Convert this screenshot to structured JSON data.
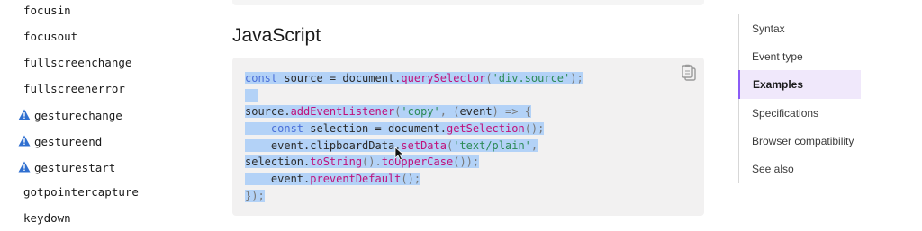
{
  "sidebar": {
    "items": [
      {
        "label": "focusin",
        "deprecated": false
      },
      {
        "label": "focusout",
        "deprecated": false
      },
      {
        "label": "fullscreenchange",
        "deprecated": false
      },
      {
        "label": "fullscreenerror",
        "deprecated": false
      },
      {
        "label": "gesturechange",
        "deprecated": true
      },
      {
        "label": "gestureend",
        "deprecated": true
      },
      {
        "label": "gesturestart",
        "deprecated": true
      },
      {
        "label": "gotpointercapture",
        "deprecated": false
      },
      {
        "label": "keydown",
        "deprecated": false
      }
    ],
    "warning_icon": "warning-triangle-icon",
    "warning_color": "#2f6fd0"
  },
  "main": {
    "heading": "JavaScript",
    "code_language": "JavaScript",
    "copy_icon": "clipboard-copy-icon",
    "selection_color": "#b3d2f7",
    "code_lines": [
      [
        [
          "kw",
          "const"
        ],
        [
          "pl",
          " source = document."
        ],
        [
          "fn",
          "querySelector"
        ],
        [
          "pun",
          "("
        ],
        [
          "str",
          "'div.source'"
        ],
        [
          "pun",
          ");"
        ]
      ],
      [],
      [
        [
          "pl",
          "source."
        ],
        [
          "fn",
          "addEventListener"
        ],
        [
          "pun",
          "("
        ],
        [
          "str",
          "'copy'"
        ],
        [
          "pun",
          ", ("
        ],
        [
          "pl",
          "event"
        ],
        [
          "pun",
          ") => {"
        ]
      ],
      [
        [
          "pl",
          "    "
        ],
        [
          "kw",
          "const"
        ],
        [
          "pl",
          " selection = document."
        ],
        [
          "fn",
          "getSelection"
        ],
        [
          "pun",
          "();"
        ]
      ],
      [
        [
          "pl",
          "    event.clipboardData."
        ],
        [
          "fn",
          "setData"
        ],
        [
          "pun",
          "("
        ],
        [
          "str",
          "'text/plain'"
        ],
        [
          "pun",
          ","
        ]
      ],
      [
        [
          "pl",
          "selection."
        ],
        [
          "fn",
          "toString"
        ],
        [
          "pun",
          "()."
        ],
        [
          "fn",
          "toUpperCase"
        ],
        [
          "pun",
          "());"
        ]
      ],
      [
        [
          "pl",
          "    event."
        ],
        [
          "fn",
          "preventDefault"
        ],
        [
          "pun",
          "();"
        ]
      ],
      [
        [
          "pun",
          "});"
        ]
      ]
    ]
  },
  "toc": {
    "items": [
      {
        "label": "Syntax",
        "active": false
      },
      {
        "label": "Event type",
        "active": false
      },
      {
        "label": "Examples",
        "active": true
      },
      {
        "label": "Specifications",
        "active": false
      },
      {
        "label": "Browser compatibility",
        "active": false
      },
      {
        "label": "See also",
        "active": false
      }
    ],
    "active_color": "#8b5cf6"
  }
}
